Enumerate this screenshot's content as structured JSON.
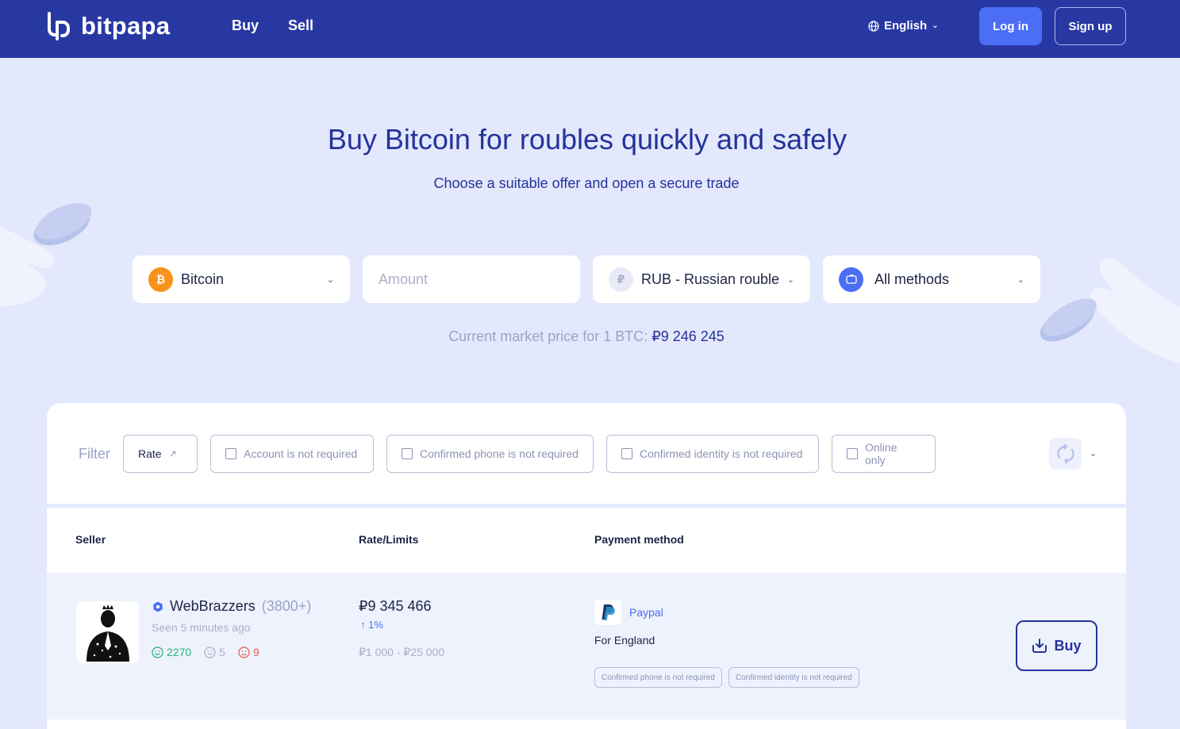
{
  "header": {
    "brand": "bitpapa",
    "nav": [
      "Buy",
      "Sell"
    ],
    "language": "English",
    "login_label": "Log in",
    "signup_label": "Sign up"
  },
  "hero": {
    "title": "Buy Bitcoin for roubles quickly and safely",
    "subtitle": "Choose a suitable offer and open a secure trade"
  },
  "selectors": {
    "crypto": "Bitcoin",
    "amount_placeholder": "Amount",
    "currency": "RUB - Russian rouble",
    "method": "All methods"
  },
  "market": {
    "label": "Current market price for 1 BTC:",
    "price": "₽9 246 245"
  },
  "filter": {
    "label": "Filter",
    "rate": "Rate",
    "options": [
      "Account is not required",
      "Confirmed phone is not required",
      "Confirmed identity is not required",
      "Online only"
    ]
  },
  "table": {
    "headers": [
      "Seller",
      "Rate/Limits",
      "Payment method"
    ],
    "rows": [
      {
        "seller": "WebBrazzers",
        "count": "(3800+)",
        "seen": "Seen 5 minutes ago",
        "positive": "2270",
        "neutral": "5",
        "negative": "9",
        "rate": "₽9 345 466",
        "rate_change": "1%",
        "limits": "₽1 000 - ₽25 000",
        "payment": "Paypal",
        "payment_desc": "For England",
        "tags": [
          "Confirmed phone is not required",
          "Confirmed identity is not required"
        ],
        "buy_label": "Buy"
      }
    ]
  },
  "colors": {
    "header_bg": "#2838a3",
    "accent": "#4b6ef5",
    "page_bg": "#e3e8fc",
    "bitcoin": "#f7931a",
    "positive": "#20b47c",
    "negative": "#e8584f"
  }
}
